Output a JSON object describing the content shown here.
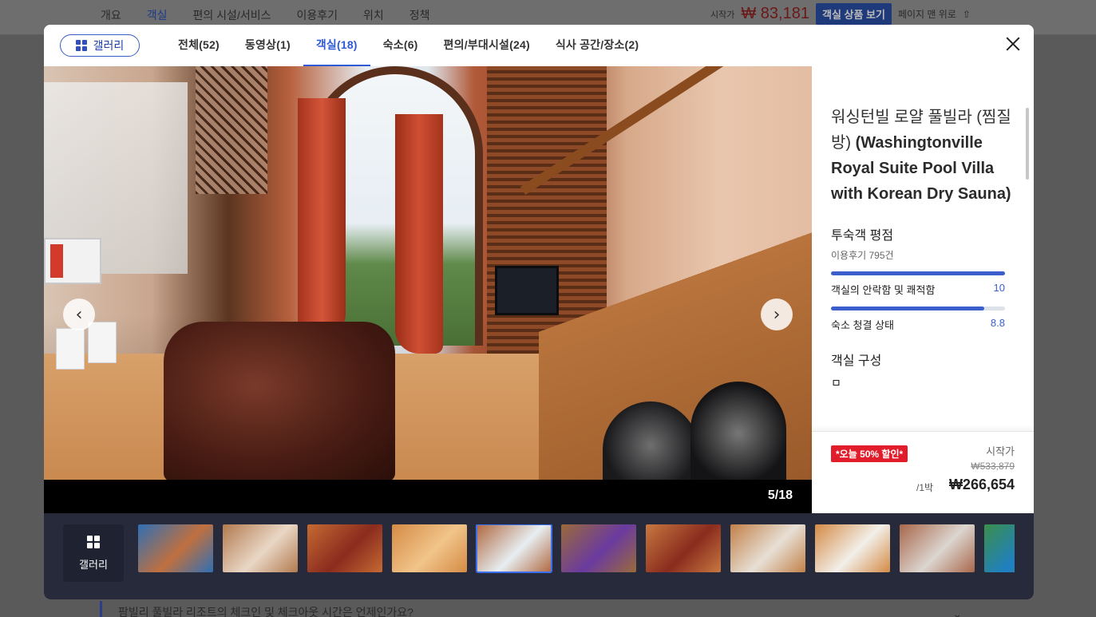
{
  "background": {
    "nav_tabs": [
      "개요",
      "객실",
      "편의 시설/서비스",
      "이용후기",
      "위치",
      "정책"
    ],
    "active_tab_index": 1,
    "from_label": "시작가",
    "price": "₩ 83,181",
    "view_button": "객실 상품 보기",
    "to_top": "페이지 맨 위로",
    "faq_question": "팜빌리 풀빌라 리조트의 체크인 및 체크아웃 시간은 언제인가요?"
  },
  "header": {
    "gallery_label": "갤러리",
    "tabs": [
      "전체(52)",
      "동영상(1)",
      "객실(18)",
      "숙소(6)",
      "편의/부대시설(24)",
      "식사 공간/장소(2)"
    ],
    "active_tab_index": 2
  },
  "photo": {
    "counter": "5/18",
    "prev_glyph": "‹",
    "next_glyph": "›"
  },
  "room": {
    "title_ko": "워싱턴빌 로얄 풀빌라 (찜질방)",
    "title_en": "(Washingtonville Royal Suite Pool Villa with Korean Dry Sauna)",
    "rating_heading": "투숙객 평점",
    "review_count": "이용후기 795건",
    "metrics": [
      {
        "label": "객실의 안락함 및 쾌적함",
        "value": "10",
        "fraction": 1.0
      },
      {
        "label": "숙소 청결 상태",
        "value": "8.8",
        "fraction": 0.88
      }
    ],
    "composition_heading": "객실 구성",
    "composition_first": "ㅁ"
  },
  "pricing": {
    "promo": "*오늘 50% 할인*",
    "from_label": "시작가",
    "original_price": "₩533,879",
    "per_night": "/1박",
    "final_price": "₩266,654"
  },
  "thumbstrip": {
    "gallery_label": "갤러리",
    "active_index": 4,
    "thumbs": [
      {
        "bg": "#2f6fb5",
        "accent": "#c0703f"
      },
      {
        "bg": "#b27a4e",
        "accent": "#e9d7c6"
      },
      {
        "bg": "#c56a33",
        "accent": "#8a2b1e"
      },
      {
        "bg": "#d58b45",
        "accent": "#f1c48a"
      },
      {
        "bg": "#b0673e",
        "accent": "#e7eef2"
      },
      {
        "bg": "#9a6a3a",
        "accent": "#6a3aa0"
      },
      {
        "bg": "#c77840",
        "accent": "#8a2b1e"
      },
      {
        "bg": "#c28048",
        "accent": "#e7e0d6"
      },
      {
        "bg": "#d48a45",
        "accent": "#f2efe9"
      },
      {
        "bg": "#a8674a",
        "accent": "#dcd5d0"
      },
      {
        "bg": "#3b8f4a",
        "accent": "#1f7fc4"
      }
    ]
  },
  "colors": {
    "accent": "#2f5ad6",
    "promo_red": "#e11d2b",
    "strip_bg": "#272a3b"
  }
}
